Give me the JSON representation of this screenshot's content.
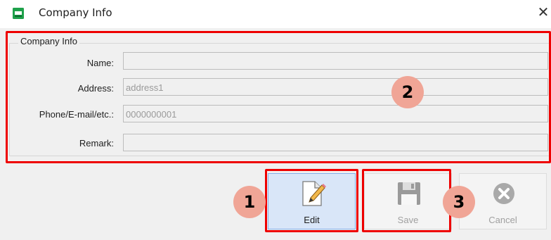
{
  "window": {
    "title": "Company Info",
    "close_glyph": "✕",
    "app_icon": "app-window-icon",
    "accent": "#1ea14a"
  },
  "group": {
    "title": "Company Info"
  },
  "fields": [
    {
      "label": "Name:",
      "value": ""
    },
    {
      "label": "Address:",
      "value": "address1"
    },
    {
      "label": "Phone/E-mail/etc.:",
      "value": "0000000001"
    },
    {
      "label": "Remark:",
      "value": ""
    }
  ],
  "toolbar": {
    "edit_label": "Edit",
    "save_label": "Save",
    "cancel_label": "Cancel",
    "edit_icon": "edit-document-pencil-icon",
    "save_icon": "floppy-disk-icon",
    "cancel_icon": "cancel-x-circle-icon"
  },
  "annotations": [
    {
      "number": "1"
    },
    {
      "number": "2"
    },
    {
      "number": "3"
    }
  ],
  "colors": {
    "highlight": "#ee0000",
    "badge": "#f0a596",
    "edit_button": "#d9e6f8"
  }
}
